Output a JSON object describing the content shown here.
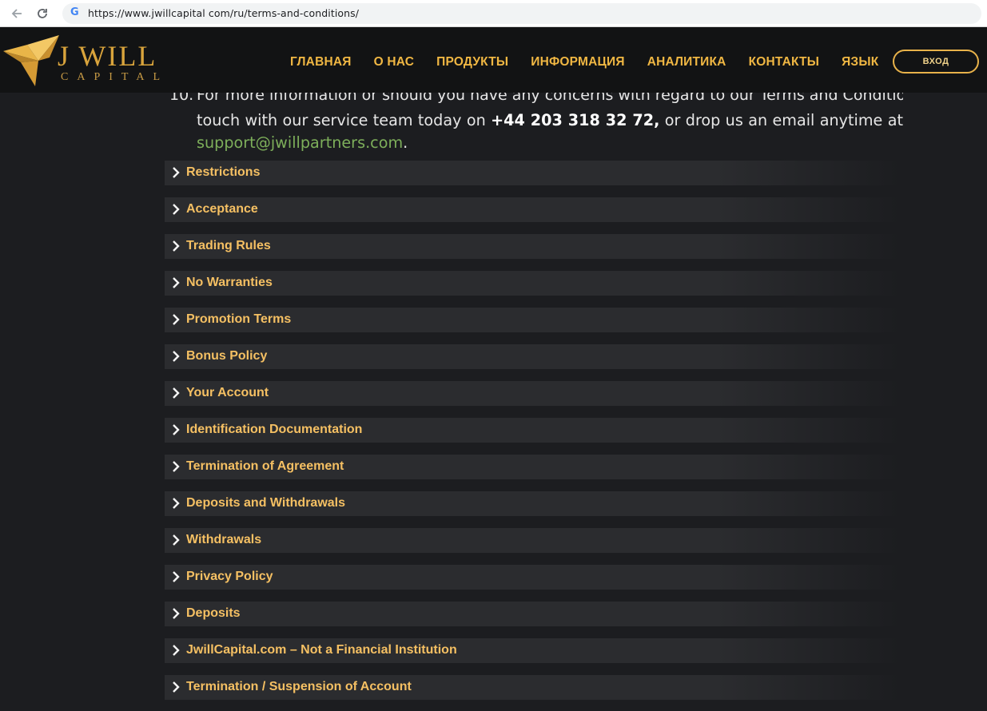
{
  "browser": {
    "back_icon": "arrow-back-icon",
    "reload_icon": "reload-icon",
    "favicon": "G",
    "url": "https://www.jwillcapital com/ru/terms-and-conditions/"
  },
  "header": {
    "logo_title": "J WILL",
    "logo_subtitle": "CAPITAL",
    "menu": [
      {
        "label": "ГЛАВНАЯ"
      },
      {
        "label": "О НАС"
      },
      {
        "label": "ПРОДУКТЫ"
      },
      {
        "label": "ИНФОРМАЦИЯ"
      },
      {
        "label": "АНАЛИТИКА"
      },
      {
        "label": "КОНТАКТЫ"
      },
      {
        "label": "ЯЗЫК"
      }
    ],
    "login_label": "ВХОД",
    "accent_color": "#f0b743"
  },
  "content": {
    "item_number": "10.",
    "line1": "For more information or should you have any concerns with regard to our Terms and Conditions, get in",
    "line2_start": "touch with our service team today on",
    "phone": "+44 203 318 32 72,",
    "line2_end": "or drop us an email anytime at",
    "email": "support@jwillpartners.com",
    "period": ".",
    "sections": [
      {
        "label": "Restrictions"
      },
      {
        "label": "Acceptance"
      },
      {
        "label": "Trading Rules"
      },
      {
        "label": "No Warranties"
      },
      {
        "label": "Promotion Terms"
      },
      {
        "label": "Bonus Policy"
      },
      {
        "label": "Your Account"
      },
      {
        "label": "Identification Documentation"
      },
      {
        "label": "Termination of Agreement"
      },
      {
        "label": "Deposits and Withdrawals"
      },
      {
        "label": "Withdrawals"
      },
      {
        "label": "Privacy Policy"
      },
      {
        "label": "Deposits"
      },
      {
        "label": "JwillCapital.com – Not a Financial Institution"
      },
      {
        "label": "Termination / Suspension of Account"
      }
    ]
  }
}
